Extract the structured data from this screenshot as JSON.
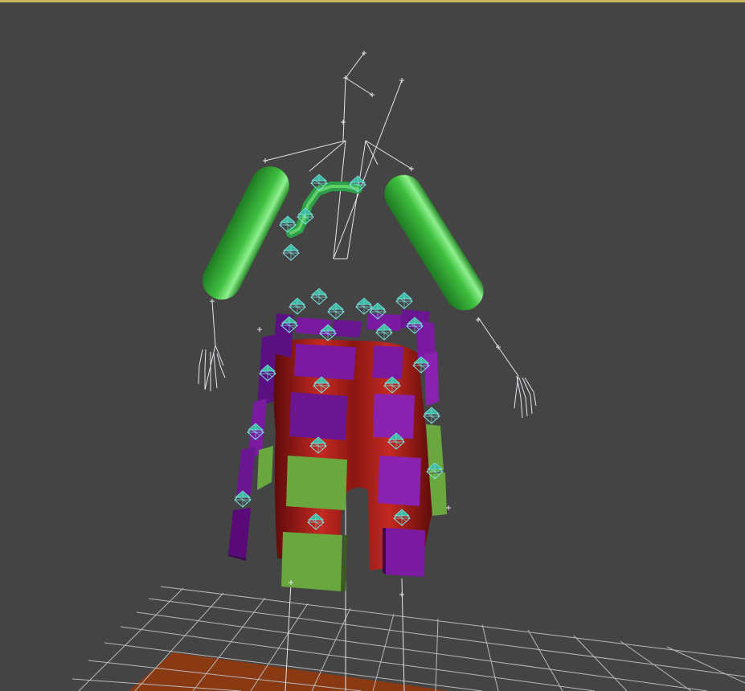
{
  "viewport": {
    "label": "",
    "background": "#444444",
    "active_border_color": "#c8b45a"
  },
  "scene": {
    "colors": {
      "grid": "#b9b9b9",
      "ground_plane": "#8a3a12",
      "bone_white": "#e6e6ee",
      "helper_cyan": "#7fe6e6",
      "helper_fill": "#3fb8a0",
      "green_capsule": "#3fbf3f",
      "green_capsule_light": "#8ef08e",
      "skirt_red": "#b4201c",
      "panel_purple": "#7a1aa0",
      "panel_purple_dark": "#3c0a50",
      "panel_green": "#6aa83f"
    },
    "objects": [
      "ground-grid",
      "ground-plane",
      "biped-skeleton",
      "left-arm-capsule",
      "right-arm-capsule",
      "neck-chain",
      "skirt-mesh",
      "cloth-panels",
      "point-helpers"
    ]
  }
}
